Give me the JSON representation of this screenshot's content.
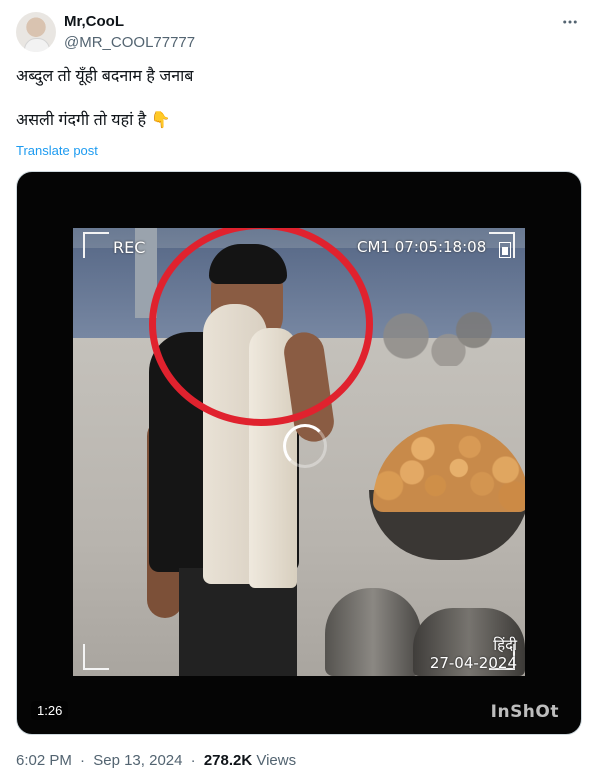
{
  "post": {
    "author": {
      "name": "Mr,CooL",
      "handle": "@MR_COOL77777",
      "avatar_icon": "profile-avatar"
    },
    "text_line1": "अब्दुल तो यूँही बदनाम है जनाब",
    "text_line2": "असली गंदगी तो यहां है 👇",
    "translate_label": "Translate post",
    "more_icon": "more-options-icon"
  },
  "video": {
    "overlay_rec": "REC",
    "overlay_cam": "CM1 07:05:18:08",
    "overlay_date_top": "हिंदी",
    "overlay_date": "27-04-2024",
    "duration": "1:26",
    "watermark": "InShOt",
    "highlight_color": "#e0222e"
  },
  "footer": {
    "time": "6:02 PM",
    "separator": "·",
    "date": "Sep 13, 2024",
    "views_count": "278.2K",
    "views_label": "Views"
  },
  "colors": {
    "text": "#0f1419",
    "secondary": "#536471",
    "link": "#1d9bf0"
  }
}
